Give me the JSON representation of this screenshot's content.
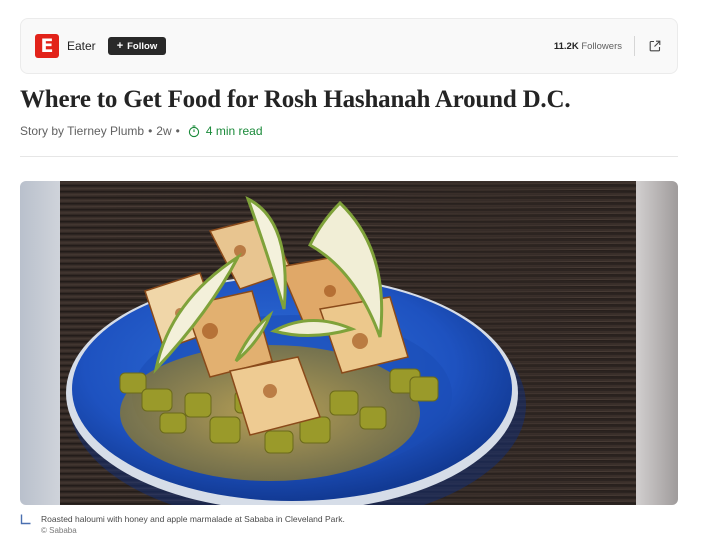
{
  "publisher": {
    "logo_letter": "E",
    "name": "Eater",
    "follow_label": "Follow",
    "follow_icon": "plus-icon",
    "followers_count": "11.2K",
    "followers_label": "Followers",
    "share_icon": "external-link-icon",
    "brand_color": "#e2231a"
  },
  "article": {
    "headline": "Where to Get Food for Rosh Hashanah Around D.C.",
    "byline": "Story by Tierney Plumb",
    "age": "2w",
    "read_time": "4 min read",
    "read_time_icon": "stopwatch-icon",
    "read_time_color": "#1a8a3a"
  },
  "image": {
    "caption": "Roasted haloumi with honey and apple marmalade at Sababa in Cleveland Park.",
    "credit": "© Sababa"
  }
}
